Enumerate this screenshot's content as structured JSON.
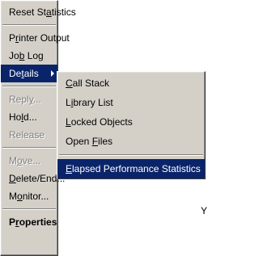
{
  "main_menu": {
    "items": [
      {
        "pre": "Reset St",
        "u": "a",
        "post": "tistics",
        "state": "normal"
      },
      {
        "separator": true
      },
      {
        "pre": "P",
        "u": "r",
        "post": "inter Output",
        "state": "normal"
      },
      {
        "pre": "Jo",
        "u": "b",
        "post": " Log",
        "state": "normal"
      },
      {
        "pre": "De",
        "u": "t",
        "post": "ails",
        "state": "selected",
        "submenu": true
      },
      {
        "separator": true
      },
      {
        "pre": "Repl",
        "u": "y",
        "post": "...",
        "state": "disabled"
      },
      {
        "pre": "Ho",
        "u": "l",
        "post": "d...",
        "state": "normal"
      },
      {
        "pre": "Release",
        "u": "",
        "post": "",
        "state": "disabled"
      },
      {
        "separator": true
      },
      {
        "pre": "M",
        "u": "o",
        "post": "ve...",
        "state": "disabled"
      },
      {
        "pre": "",
        "u": "D",
        "post": "elete/End...",
        "state": "normal"
      },
      {
        "pre": "M",
        "u": "o",
        "post": "nitor...",
        "state": "normal"
      },
      {
        "separator": true
      },
      {
        "pre": "P",
        "u": "r",
        "post": "operties",
        "state": "normal",
        "bold": true
      }
    ]
  },
  "sub_menu": {
    "items": [
      {
        "pre": "",
        "u": "C",
        "post": "all Stack",
        "state": "normal"
      },
      {
        "pre": "L",
        "u": "i",
        "post": "brary List",
        "state": "normal"
      },
      {
        "pre": "",
        "u": "L",
        "post": "ocked Objects",
        "state": "normal"
      },
      {
        "pre": "Open ",
        "u": "F",
        "post": "iles",
        "state": "normal"
      },
      {
        "separator": true
      },
      {
        "pre": "",
        "u": "E",
        "post": "lapsed Performance Statistics",
        "state": "selected"
      }
    ]
  },
  "background_mark": "Y",
  "colors": {
    "menu_bg": "#d4d0c8",
    "highlight": "#0a246a",
    "disabled": "#808080"
  }
}
